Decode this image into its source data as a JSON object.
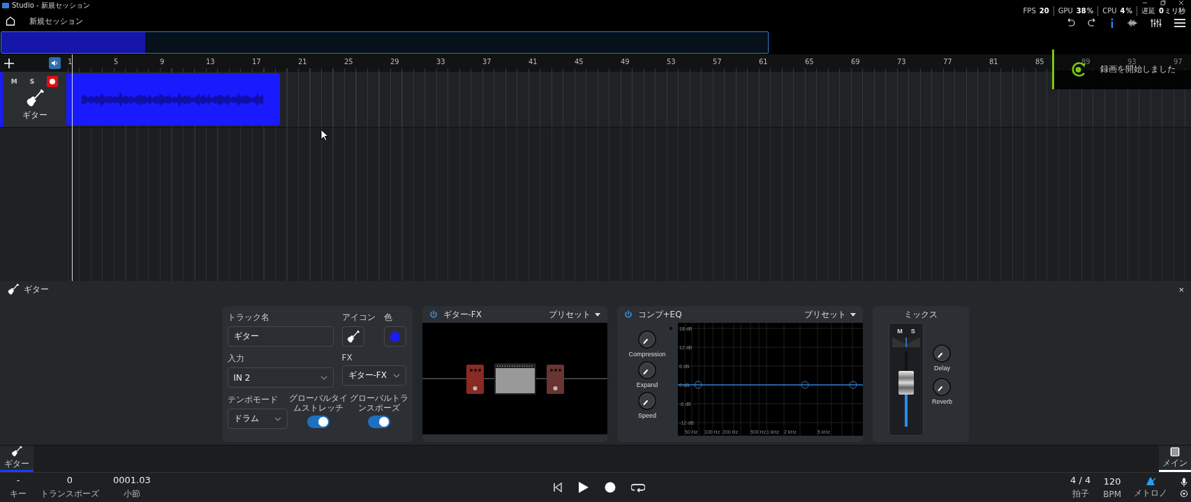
{
  "window": {
    "title": "Studio - 新規セッション"
  },
  "header": {
    "session_name": "新規セッション",
    "stats": [
      {
        "label": "FPS",
        "value": "20"
      },
      {
        "label": "GPU",
        "value": "38",
        "unit": "%"
      },
      {
        "label": "CPU",
        "value": "4",
        "unit": "%"
      },
      {
        "label": "遅延",
        "value": "0",
        "unit": "ミリ秒"
      }
    ]
  },
  "ruler": {
    "marks": [
      "1",
      "5",
      "9",
      "13",
      "17",
      "21",
      "25",
      "29",
      "33",
      "37",
      "41",
      "45",
      "49",
      "53",
      "57",
      "61",
      "65",
      "69",
      "73",
      "77",
      "81",
      "85",
      "89",
      "93",
      "97"
    ]
  },
  "tracks": [
    {
      "name": "ギター",
      "mute": "M",
      "solo": "S",
      "color": "#1a1aff"
    }
  ],
  "notification": {
    "message": "録画を開始しました"
  },
  "track_panel": {
    "title": "ギター",
    "close": "×",
    "settings": {
      "name_label": "トラック名",
      "name_value": "ギター",
      "icon_label": "アイコン",
      "color_label": "色",
      "input_label": "入力",
      "input_value": "IN 2",
      "fx_label": "FX",
      "fx_value": "ギター-FX",
      "tempo_label": "テンポモード",
      "tempo_value": "ドラム",
      "toggles": [
        {
          "label": "グローバルタイムストレッチ",
          "on": true
        },
        {
          "label": "グローバルトランスポーズ",
          "on": true
        }
      ]
    },
    "fx": {
      "title": "ギター-FX",
      "on": true,
      "preset": "プリセット"
    },
    "comp_eq": {
      "title": "コンプ+EQ",
      "on": true,
      "preset": "プリセット",
      "knobs": [
        "Compression",
        "Expand",
        "Speed"
      ],
      "db_labels": [
        "18 dB",
        "12 dB",
        "6 dB",
        "0 dB",
        "-6 dB",
        "-12 dB"
      ],
      "freq_labels": [
        "50 Hz",
        "100 Hz",
        "200 Hz",
        "500 Hz",
        "1 kHz",
        "2 kHz",
        "5 kHz"
      ]
    },
    "mix": {
      "title": "ミックス",
      "mute": "M",
      "solo": "S",
      "level": 0.62,
      "knobs": [
        "Delay",
        "Reverb"
      ]
    }
  },
  "track_tabs": [
    {
      "label": "ギター",
      "selected": true
    }
  ],
  "main_tab": {
    "label": "メイン",
    "selected": true
  },
  "transport": {
    "left": [
      {
        "value": "-",
        "label": "キー"
      },
      {
        "value": "0",
        "label": "トランスポーズ"
      },
      {
        "value": "0001.03",
        "label": "小節"
      }
    ],
    "right": [
      {
        "value": "4 / 4",
        "label": "拍子"
      },
      {
        "value": "120",
        "label": "BPM"
      }
    ],
    "metronome_label": "メトロノ"
  }
}
